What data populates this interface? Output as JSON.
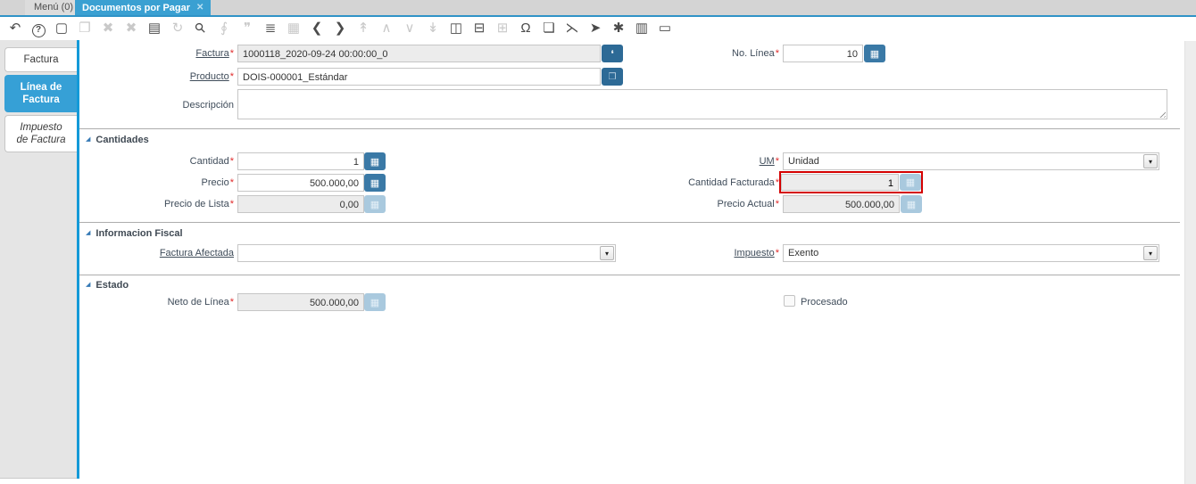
{
  "window": {
    "tabs": [
      {
        "label": "Menú (0)",
        "active": false
      },
      {
        "label": "Documentos por Pagar",
        "active": true
      }
    ]
  },
  "toolbar": {
    "icons": [
      {
        "name": "undo-icon",
        "glyph": "↶",
        "enabled": true
      },
      {
        "name": "help-icon",
        "glyph": "?",
        "enabled": true,
        "cls": "circled"
      },
      {
        "name": "new-record-icon",
        "glyph": "▢",
        "enabled": true
      },
      {
        "name": "copy-record-icon",
        "glyph": "❐",
        "enabled": false
      },
      {
        "name": "delete-record-icon",
        "glyph": "✖",
        "enabled": false
      },
      {
        "name": "delete-selection-icon",
        "glyph": "✖",
        "enabled": false
      },
      {
        "name": "save-icon",
        "glyph": "▤",
        "enabled": true
      },
      {
        "name": "refresh-icon",
        "glyph": "↻",
        "enabled": false
      },
      {
        "name": "find-icon",
        "glyph": "⚲",
        "enabled": true,
        "cls": "rot45"
      },
      {
        "name": "attachment-icon",
        "glyph": "∮",
        "enabled": false
      },
      {
        "name": "chat-icon",
        "glyph": "❞",
        "enabled": false
      },
      {
        "name": "grid-toggle-icon",
        "glyph": "≣",
        "enabled": true
      },
      {
        "name": "calendar-icon",
        "glyph": "▦",
        "enabled": false
      },
      {
        "name": "prev-record-icon",
        "glyph": "❮",
        "enabled": true
      },
      {
        "name": "next-record-icon",
        "glyph": "❯",
        "enabled": true
      },
      {
        "name": "first-record-icon",
        "glyph": "↟",
        "enabled": false
      },
      {
        "name": "parent-record-icon",
        "glyph": "∧",
        "enabled": false
      },
      {
        "name": "detail-record-icon",
        "glyph": "∨",
        "enabled": false
      },
      {
        "name": "last-record-icon",
        "glyph": "↡",
        "enabled": false
      },
      {
        "name": "report-icon",
        "glyph": "◫",
        "enabled": true
      },
      {
        "name": "archive-icon",
        "glyph": "⊟",
        "enabled": true
      },
      {
        "name": "print-icon",
        "glyph": "⊞",
        "enabled": false
      },
      {
        "name": "lock-icon",
        "glyph": "Ω",
        "enabled": true
      },
      {
        "name": "zoom-across-icon",
        "glyph": "❏",
        "enabled": true
      },
      {
        "name": "workflow-icon",
        "glyph": "⋋",
        "enabled": true
      },
      {
        "name": "send-mail-icon",
        "glyph": "➤",
        "enabled": true
      },
      {
        "name": "preferences-icon",
        "glyph": "✱",
        "enabled": true
      },
      {
        "name": "product-info-icon",
        "glyph": "▥",
        "enabled": true
      },
      {
        "name": "quick-form-icon",
        "glyph": "▭",
        "enabled": true
      }
    ]
  },
  "sidebar": {
    "tabs": [
      {
        "id": "factura",
        "label": "Factura",
        "active": false,
        "italic": false
      },
      {
        "id": "linea-de-factura",
        "label": "Línea de\nFactura",
        "active": true,
        "italic": false
      },
      {
        "id": "impuesto-de-factura",
        "label": "Impuesto\nde Factura",
        "active": false,
        "italic": true
      }
    ]
  },
  "sections": {
    "cantidades": "Cantidades",
    "fiscal": "Informacion Fiscal",
    "estado": "Estado"
  },
  "form": {
    "factura": {
      "label": "Factura",
      "value": "1000118_2020-09-24 00:00:00_0"
    },
    "no_linea": {
      "label": "No. Línea",
      "value": "10"
    },
    "producto": {
      "label": "Producto",
      "value": "DOIS-000001_Estándar"
    },
    "descripcion": {
      "label": "Descripción",
      "value": ""
    },
    "cantidad": {
      "label": "Cantidad",
      "value": "1"
    },
    "um": {
      "label": "UM",
      "value": "Unidad"
    },
    "precio": {
      "label": "Precio",
      "value": "500.000,00"
    },
    "cantidad_facturada": {
      "label": "Cantidad Facturada",
      "value": "1"
    },
    "precio_lista": {
      "label": "Precio de Lista",
      "value": "0,00"
    },
    "precio_actual": {
      "label": "Precio Actual",
      "value": "500.000,00"
    },
    "factura_afectada": {
      "label": "Factura Afectada",
      "value": ""
    },
    "impuesto": {
      "label": "Impuesto",
      "value": "Exento"
    },
    "neto_linea": {
      "label": "Neto de Línea",
      "value": "500.000,00"
    },
    "procesado": {
      "label": "Procesado",
      "checked": false
    }
  },
  "ui": {
    "close_tab_glyph": "✕",
    "calc_glyph": "▦",
    "record_glyph": "❛",
    "search_glyph": "❒",
    "dropdown_glyph": "▾",
    "collapse_glyph": "◢",
    "colors": {
      "accent_blue": "#3aa0d2",
      "button_blue": "#3a79a6",
      "highlight_red": "#d40000"
    }
  }
}
